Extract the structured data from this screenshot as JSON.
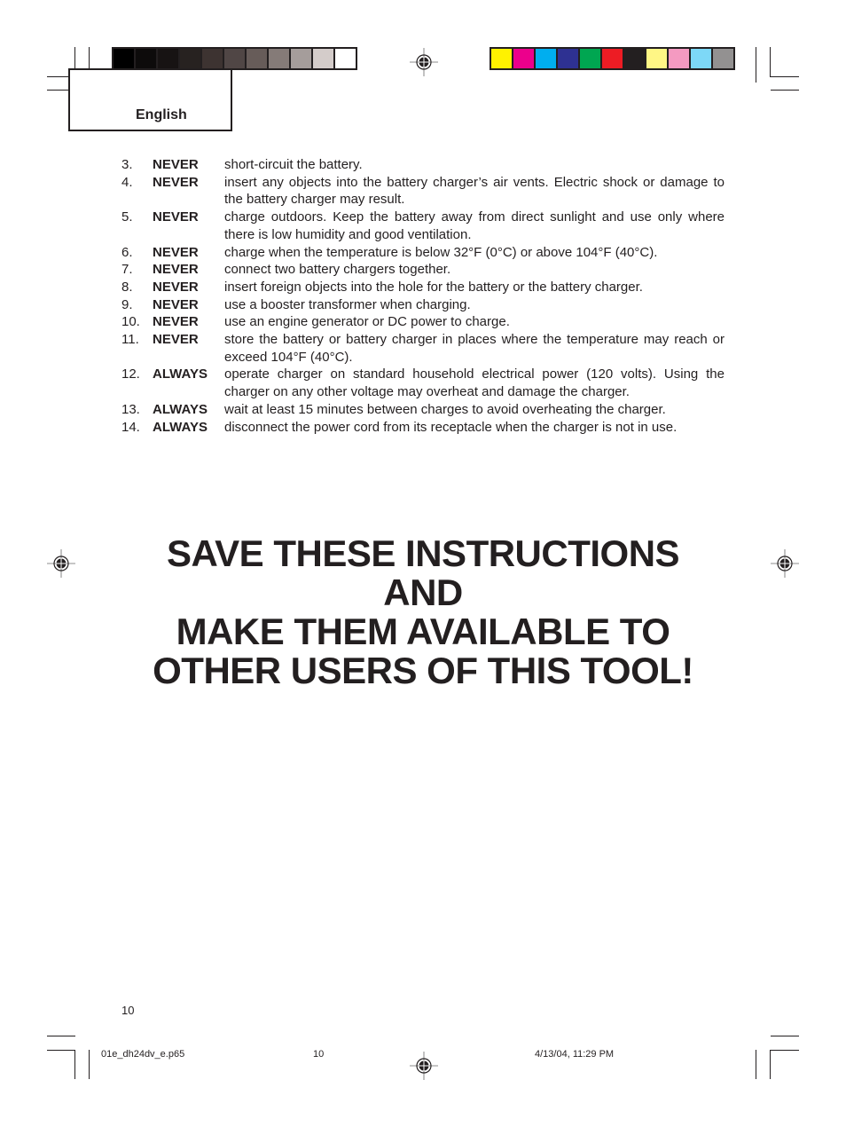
{
  "header": {
    "language_tab": "English",
    "grayscale_bar": [
      "#000000",
      "#0d0b0b",
      "#171313",
      "#272220",
      "#3d3331",
      "#504645",
      "#675c59",
      "#857b78",
      "#a59d9b",
      "#d4ccca",
      "#ffffff"
    ],
    "color_bar": [
      "#fff200",
      "#ec008c",
      "#00aeef",
      "#2e3192",
      "#00a651",
      "#ed1c24",
      "#231f20",
      "#fff685",
      "#f49ac1",
      "#7dd8f7",
      "#939191"
    ]
  },
  "rules": [
    {
      "num": "3.",
      "keyword": "NEVER",
      "text": "short-circuit the battery."
    },
    {
      "num": "4.",
      "keyword": "NEVER",
      "text": "insert any objects into the battery charger’s air vents. Electric shock or damage to the battery charger may result."
    },
    {
      "num": "5.",
      "keyword": "NEVER",
      "text": "charge outdoors. Keep the battery away from direct sunlight and use only where there is low humidity and good ventilation."
    },
    {
      "num": "6.",
      "keyword": "NEVER",
      "text": "charge when the temperature is below 32°F (0°C) or above 104°F (40°C)."
    },
    {
      "num": "7.",
      "keyword": "NEVER",
      "text": "connect two battery chargers together."
    },
    {
      "num": "8.",
      "keyword": "NEVER",
      "text": "insert foreign objects into the hole for the battery or the battery charger."
    },
    {
      "num": "9.",
      "keyword": "NEVER",
      "text": "use a booster transformer when charging."
    },
    {
      "num": "10.",
      "keyword": "NEVER",
      "text": "use an engine generator or DC power to charge."
    },
    {
      "num": "11.",
      "keyword": "NEVER",
      "text": "store the battery or battery charger in places where the temperature may reach or exceed 104°F (40°C)."
    },
    {
      "num": "12.",
      "keyword": "ALWAYS",
      "text": "operate charger on standard household electrical power (120 volts). Using the charger on any other voltage may overheat and damage the charger."
    },
    {
      "num": "13.",
      "keyword": "ALWAYS",
      "text": "wait at least 15 minutes between charges to avoid overheating the charger."
    },
    {
      "num": "14.",
      "keyword": "ALWAYS",
      "text": "disconnect the power cord from its receptacle when the charger is not in use."
    }
  ],
  "headline": {
    "lines": [
      "SAVE THESE INSTRUCTIONS",
      "AND",
      "MAKE THEM AVAILABLE TO",
      "OTHER USERS OF THIS TOOL!"
    ]
  },
  "footer": {
    "page_number": "10",
    "file_name": "01e_dh24dv_e.p65",
    "slug_page": "10",
    "timestamp": "4/13/04, 11:29 PM"
  }
}
